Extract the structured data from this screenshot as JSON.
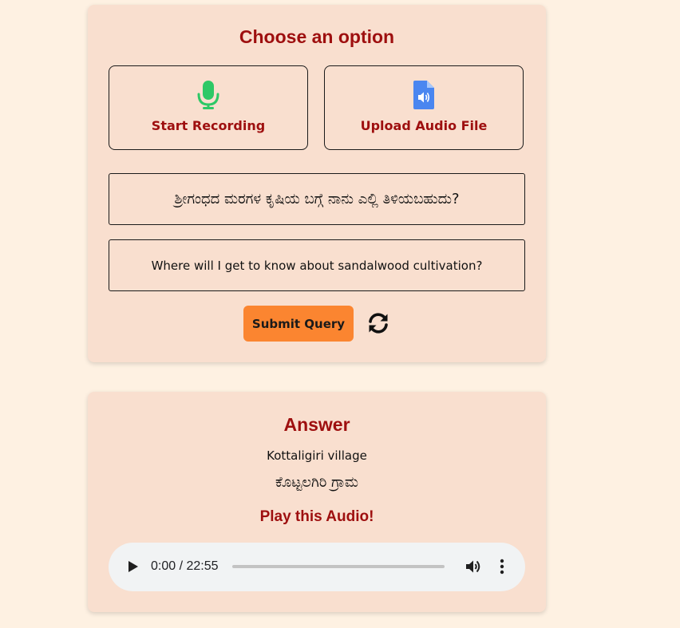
{
  "query_card": {
    "title": "Choose an option",
    "options": {
      "record_label": "Start Recording",
      "record_icon": "microphone-icon",
      "upload_label": "Upload Audio File",
      "upload_icon": "audio-file-icon"
    },
    "native_query": "ಶ್ರೀಗಂಧದ ಮರಗಳ ಕೃಷಿಯ ಬಗ್ಗೆ ನಾನು ಎಲ್ಲಿ ತಿಳಿಯಬಹುದು?",
    "english_query": "Where will I get to know about sandalwood cultivation?",
    "submit_label": "Submit Query",
    "refresh_icon": "refresh-icon"
  },
  "answer_card": {
    "title": "Answer",
    "answer_en": "Kottaligiri village",
    "answer_native": "ಕೊಟ್ಟಲಗಿರಿ ಗ್ರಾಮ",
    "play_label": "Play this Audio!",
    "audio": {
      "time_display": "0:00 / 22:55",
      "progress": 0
    }
  },
  "colors": {
    "page_background": "#fef1e2",
    "card_background": "#f9dfcf",
    "accent_red": "#9e0f0f",
    "submit_orange": "#fb8530",
    "mic_green": "#2ec866",
    "file_blue": "#4a86f0"
  }
}
